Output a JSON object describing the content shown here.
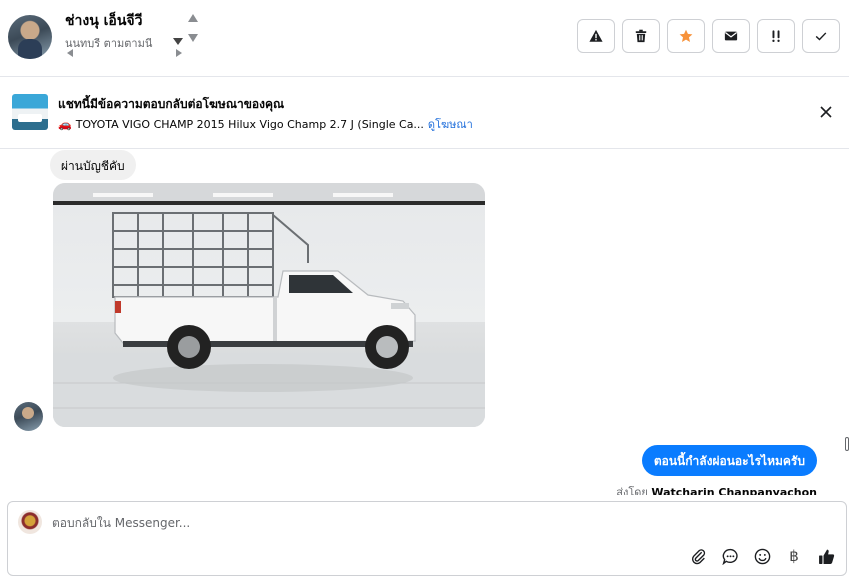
{
  "header": {
    "contact_name": "ช่างนุ เอ็นจีวี",
    "contact_subtitle": "นนทบุรี ตามตามนี้",
    "actions": [
      {
        "id": "spam",
        "icon": "warning-icon"
      },
      {
        "id": "delete",
        "icon": "trash-icon"
      },
      {
        "id": "star",
        "icon": "star-icon"
      },
      {
        "id": "unread",
        "icon": "envelope-icon"
      },
      {
        "id": "priority",
        "icon": "follow-up-icon"
      },
      {
        "id": "done",
        "icon": "check-icon"
      }
    ]
  },
  "ad_banner": {
    "title": "แชทนี้มีข้อความตอบกลับต่อโฆษณาของคุณ",
    "product": "TOYOTA VIGO CHAMP 2015 Hilux Vigo Champ 2.7 J (Single Ca...",
    "link": "ดูโฆษณา"
  },
  "conversation": {
    "incoming_text": "ผ่านบัญชีคับ",
    "outgoing_text": "ตอนนี้กำลังผ่อนอะไรไหมครับ",
    "sent_by_prefix": "ส่งโดย",
    "sent_by_name": "Watcharin Chanpanyachon"
  },
  "composer": {
    "placeholder": "ตอบกลับใน Messenger...",
    "currency_symbol": "฿"
  },
  "colors": {
    "accent_blue": "#0a7cff",
    "star_orange": "#f7923a",
    "link_blue": "#216fdb"
  }
}
